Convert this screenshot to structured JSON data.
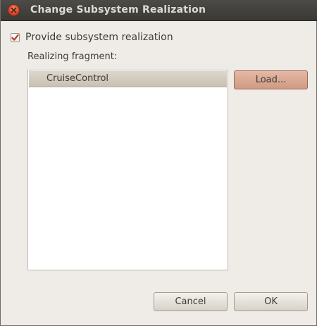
{
  "window": {
    "title": "Change Subsystem Realization"
  },
  "provide_checkbox": {
    "label": "Provide subsystem realization",
    "checked": true
  },
  "fragment": {
    "label": "Realizing fragment:",
    "items": [
      "CruiseControl"
    ],
    "load_label": "Load..."
  },
  "footer": {
    "cancel_label": "Cancel",
    "ok_label": "OK"
  },
  "colors": {
    "accent": "#d9472b",
    "titlebar": "#3c3b37"
  },
  "icons": {
    "close": "close-icon",
    "check": "checkmark-icon"
  }
}
